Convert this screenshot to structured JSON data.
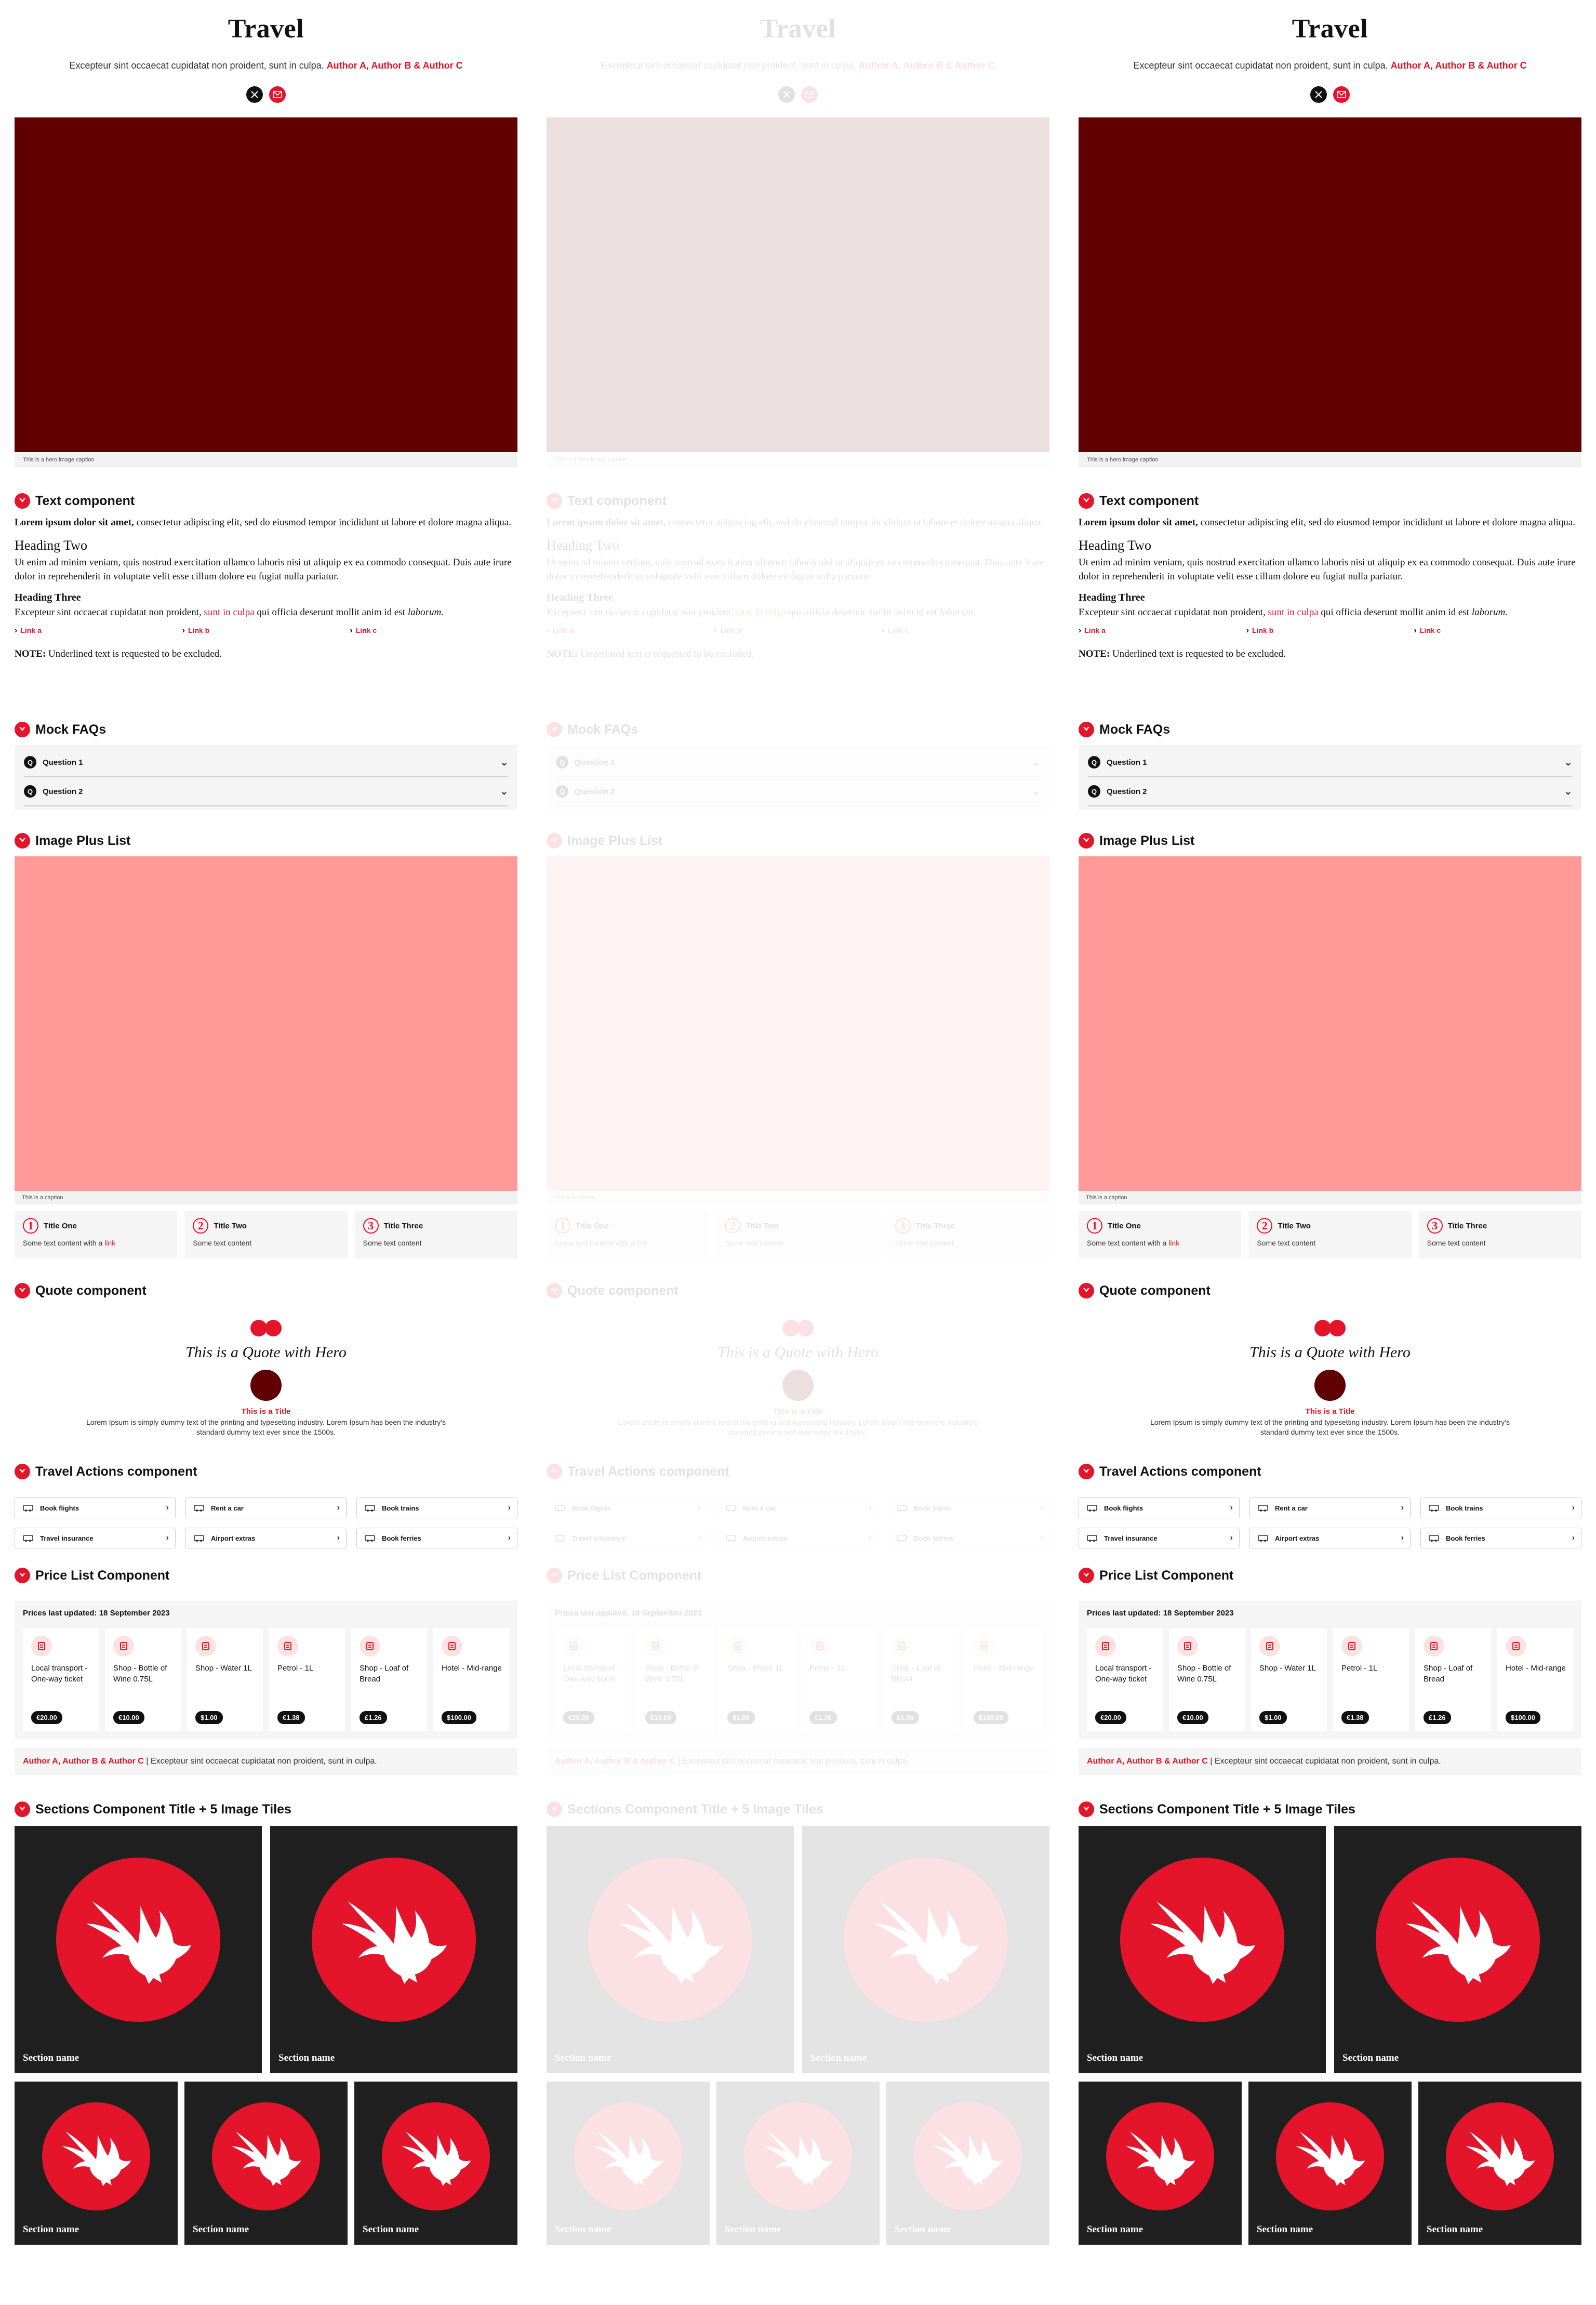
{
  "header": {
    "title": "Travel",
    "byline_text": "Excepteur sint occaecat cupidatat non proident, sunt in culpa.",
    "byline_authors": "Author A, Author B & Author C",
    "share_icons": [
      "x-icon",
      "mail-icon"
    ]
  },
  "hero": {
    "color": "#600000",
    "caption": "This is a hero image caption"
  },
  "text_component": {
    "heading": "Text component",
    "p1_bold": "Lorem ipsum dolor sit amet,",
    "p1_rest": " consectetur adipiscing elit, sed do eiusmod tempor incididunt ut labore et dolore magna aliqua.",
    "h2": "Heading Two",
    "p2": "Ut enim ad minim veniam, quis nostrud exercitation ullamco laboris nisi ut aliquip ex ea commodo consequat. Duis aute irure dolor in reprehenderit in voluptate velit esse cillum dolore eu fugiat nulla pariatur.",
    "h3": "Heading Three",
    "p3_a": "Excepteur sint occaecat cupidatat non proident, ",
    "p3_link": "sunt in culpa",
    "p3_b": " qui officia deserunt mollit anim id est ",
    "p3_italic": "laborum.",
    "links": [
      "Link a",
      "Link b",
      "Link c"
    ],
    "note_bold": "NOTE:",
    "note_rest": " Underlined text is requested to be excluded."
  },
  "faqs": {
    "heading": "Mock FAQs",
    "items": [
      "Question 1",
      "Question 2"
    ]
  },
  "image_plus_list": {
    "heading": "Image Plus List",
    "color": "#ff9a98",
    "caption": "This is a caption",
    "items": [
      {
        "num": "1",
        "title": "Title One",
        "text": "Some text content with a ",
        "link": "link"
      },
      {
        "num": "2",
        "title": "Title Two",
        "text": "Some text content",
        "link": ""
      },
      {
        "num": "3",
        "title": "Title Three",
        "text": "Some text content",
        "link": ""
      }
    ]
  },
  "quote": {
    "heading": "Quote component",
    "text": "This is a Quote with Hero",
    "title": "This is a Title",
    "body": "Lorem Ipsum is simply dummy text of the printing and typesetting industry. Lorem Ipsum has been the industry's standard dummy text ever since the 1500s."
  },
  "travel_actions": {
    "heading": "Travel Actions component",
    "items": [
      {
        "label": "Book flights",
        "icon": "plane-icon"
      },
      {
        "label": "Rent a car",
        "icon": "car-icon"
      },
      {
        "label": "Book trains",
        "icon": "train-icon"
      },
      {
        "label": "Travel insurance",
        "icon": "insurance-icon"
      },
      {
        "label": "Airport extras",
        "icon": "airport-bus-icon"
      },
      {
        "label": "Book ferries",
        "icon": "ferry-icon"
      }
    ]
  },
  "price_list": {
    "heading": "Price List Component",
    "updated": "Prices last updated: 18 September 2023",
    "items": [
      {
        "label": "Local transport - One-way ticket",
        "price": "€20.00",
        "icon": "ticket-icon"
      },
      {
        "label": "Shop - Bottle of Wine 0.75L",
        "price": "€10.00",
        "icon": "wine-icon"
      },
      {
        "label": "Shop - Water 1L",
        "price": "$1.00",
        "icon": "water-bottle-icon"
      },
      {
        "label": "Petrol - 1L",
        "price": "€1.38",
        "icon": "petrol-icon"
      },
      {
        "label": "Shop - Loaf of Bread",
        "price": "£1.26",
        "icon": "bread-icon"
      },
      {
        "label": "Hotel - Mid-range",
        "price": "$100.00",
        "icon": "hotel-bed-icon"
      }
    ],
    "footer_authors": "Author A, Author B & Author C",
    "footer_text": " | Excepteur sint occaecat cupidatat non proident, sunt in culpa."
  },
  "sections": {
    "heading": "Sections Component Title + 5 Image Tiles",
    "tiles": [
      "Section name",
      "Section name",
      "Section name",
      "Section name",
      "Section name"
    ]
  },
  "colors": {
    "accent": "#e4152a",
    "tile_background": "#202020",
    "panel_background": "#f5f5f5"
  }
}
